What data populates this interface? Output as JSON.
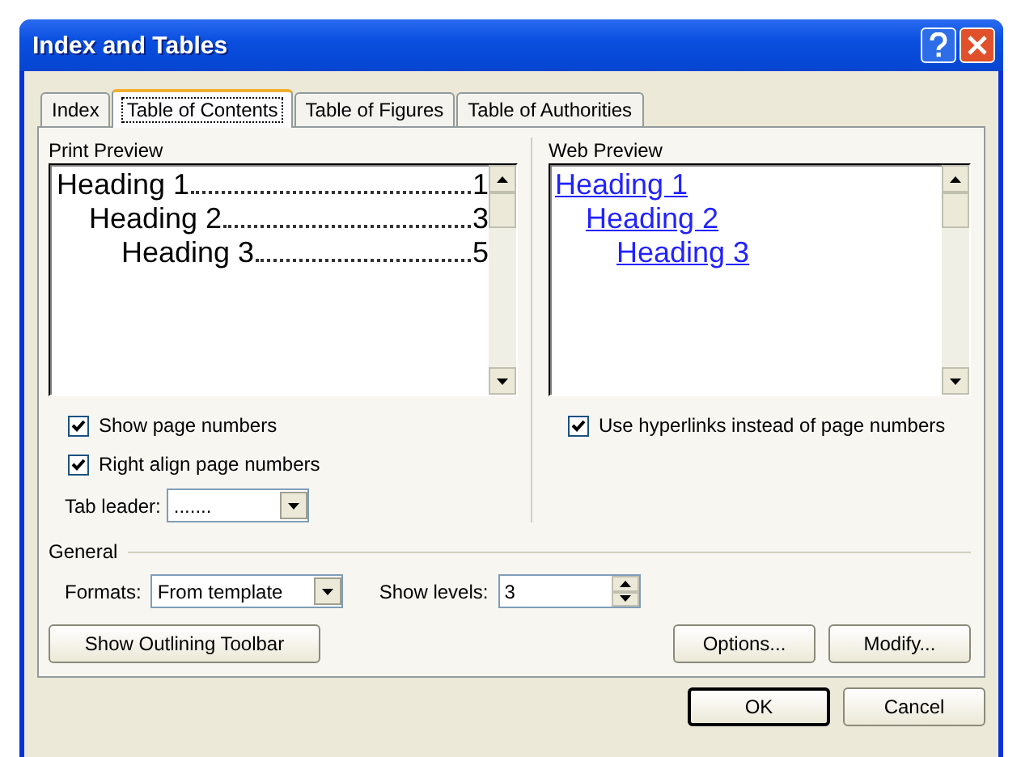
{
  "window": {
    "title": "Index and Tables"
  },
  "tabs": [
    {
      "label": "Index",
      "selected": false
    },
    {
      "label": "Table of Contents",
      "selected": true
    },
    {
      "label": "Table of Figures",
      "selected": false
    },
    {
      "label": "Table of Authorities",
      "selected": false
    }
  ],
  "print_preview": {
    "label": "Print Preview",
    "entries": [
      {
        "text": "Heading 1",
        "page": "1",
        "children": [
          {
            "text": "Heading 2",
            "page": "3",
            "children": [
              {
                "text": "Heading 3",
                "page": "5"
              }
            ]
          }
        ]
      }
    ]
  },
  "print_options": [
    {
      "label": "Show page numbers",
      "checked": true
    },
    {
      "label": "Right align page numbers",
      "checked": true
    }
  ],
  "tab_leader": {
    "label": "Tab leader:",
    "value": "......."
  },
  "web_preview": {
    "label": "Web Preview",
    "entries": [
      {
        "text": "Heading 1",
        "children": [
          {
            "text": "Heading 2",
            "children": [
              {
                "text": "Heading 3"
              }
            ]
          }
        ]
      }
    ]
  },
  "web_options": [
    {
      "label": "Use hyperlinks instead of page numbers",
      "checked": true
    }
  ],
  "general": {
    "label": "General",
    "formats": {
      "label": "Formats:",
      "value": "From template"
    },
    "show_levels": {
      "label": "Show levels:",
      "value": "3"
    }
  },
  "tool_buttons": [
    "Show Outlining Toolbar",
    "Options...",
    "Modify..."
  ],
  "dialog_buttons": [
    {
      "label": "OK",
      "default": true
    },
    {
      "label": "Cancel",
      "default": false
    }
  ]
}
